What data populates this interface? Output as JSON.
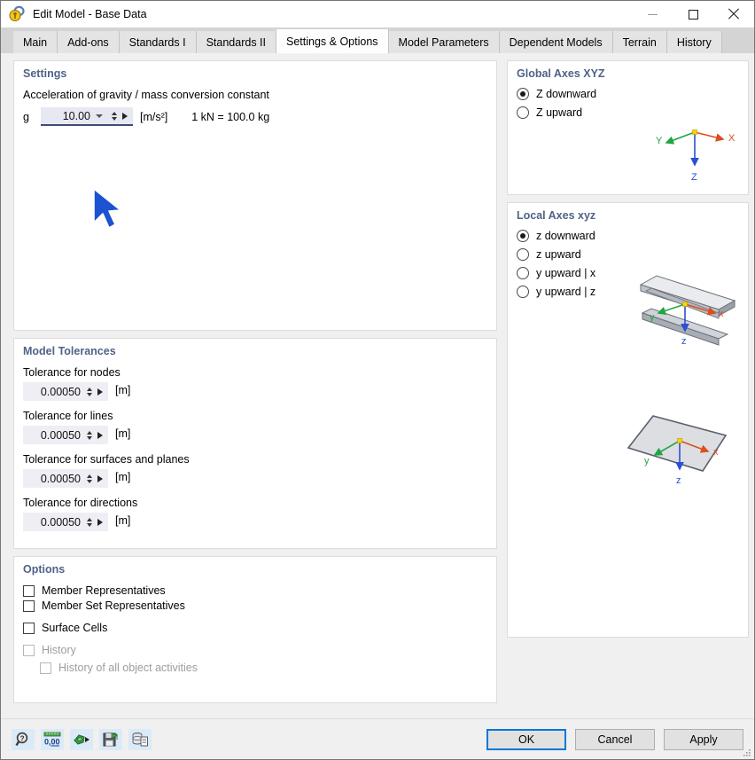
{
  "window": {
    "title": "Edit Model - Base Data",
    "icon": "app-lock-icon",
    "minimize_label": "Minimize",
    "maximize_label": "Maximize",
    "close_label": "Close"
  },
  "tabs": [
    {
      "label": "Main",
      "active": false
    },
    {
      "label": "Add-ons",
      "active": false
    },
    {
      "label": "Standards I",
      "active": false
    },
    {
      "label": "Standards II",
      "active": false
    },
    {
      "label": "Settings & Options",
      "active": true
    },
    {
      "label": "Model Parameters",
      "active": false
    },
    {
      "label": "Dependent Models",
      "active": false
    },
    {
      "label": "Terrain",
      "active": false
    },
    {
      "label": "History",
      "active": false
    }
  ],
  "settings": {
    "title": "Settings",
    "gravity_caption": "Acceleration of gravity / mass conversion constant",
    "gravity_symbol": "g",
    "gravity_value": "10.00",
    "gravity_unit": "[m/s²]",
    "gravity_note": "1 kN = 100.0 kg"
  },
  "tolerances": {
    "title": "Model Tolerances",
    "items": [
      {
        "label": "Tolerance for nodes",
        "value": "0.00050",
        "unit": "[m]"
      },
      {
        "label": "Tolerance for lines",
        "value": "0.00050",
        "unit": "[m]"
      },
      {
        "label": "Tolerance for surfaces and planes",
        "value": "0.00050",
        "unit": "[m]"
      },
      {
        "label": "Tolerance for directions",
        "value": "0.00050",
        "unit": "[m]"
      }
    ]
  },
  "options": {
    "title": "Options",
    "items": [
      {
        "label": "Member Representatives",
        "checked": false,
        "disabled": false
      },
      {
        "label": "Member Set Representatives",
        "checked": false,
        "disabled": false
      },
      {
        "label": "Surface Cells",
        "checked": false,
        "disabled": false
      },
      {
        "label": "History",
        "checked": false,
        "disabled": true
      },
      {
        "label": "History of all object activities",
        "checked": false,
        "disabled": true
      }
    ]
  },
  "global_axes": {
    "title": "Global Axes XYZ",
    "options": [
      {
        "label": "Z downward",
        "selected": true
      },
      {
        "label": "Z upward",
        "selected": false
      }
    ],
    "graphic_labels": {
      "x": "X",
      "y": "Y",
      "z": "Z"
    }
  },
  "local_axes": {
    "title": "Local Axes xyz",
    "options": [
      {
        "label": "z downward",
        "selected": true
      },
      {
        "label": "z upward",
        "selected": false
      },
      {
        "label": "y upward | x",
        "selected": false
      },
      {
        "label": "y upward | z",
        "selected": false
      }
    ],
    "beam_labels": {
      "x": "x",
      "y": "y",
      "z": "z"
    },
    "plane_labels": {
      "x": "x",
      "y": "y",
      "z": "z"
    }
  },
  "footer": {
    "tools": [
      {
        "name": "help-search-icon",
        "label": "Help"
      },
      {
        "name": "number-format-icon",
        "label": "0,00"
      },
      {
        "name": "units-convert-icon",
        "label": "Units"
      },
      {
        "name": "save-defaults-icon",
        "label": "Save as default"
      },
      {
        "name": "copy-from-model-icon",
        "label": "Copy from model"
      }
    ],
    "buttons": [
      {
        "label": "OK",
        "primary": true
      },
      {
        "label": "Cancel",
        "primary": false
      },
      {
        "label": "Apply",
        "primary": false
      }
    ]
  },
  "colors": {
    "accent": "#0078d7",
    "panel_title": "#4f6388",
    "axis_x": "#d94f1e",
    "axis_y": "#1fa544",
    "axis_z": "#2a4fd6",
    "origin": "#ffd400",
    "cursor": "#1b53d0"
  }
}
